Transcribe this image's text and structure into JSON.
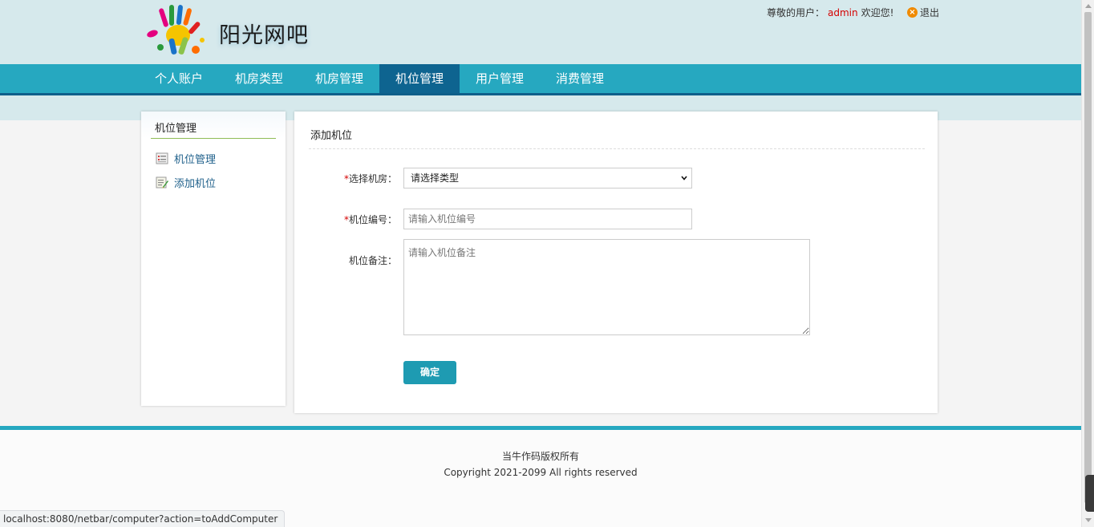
{
  "brand": {
    "site_name": "阳光网吧",
    "logo_icon": "colorful-hands-icon"
  },
  "userbar": {
    "greeting": "尊敬的用户：",
    "username": "admin",
    "welcome": "欢迎您!",
    "logout_label": "退出",
    "logout_icon": "logout-icon"
  },
  "nav": {
    "items": [
      {
        "label": "个人账户"
      },
      {
        "label": "机房类型"
      },
      {
        "label": "机房管理"
      },
      {
        "label": "机位管理"
      },
      {
        "label": "用户管理"
      },
      {
        "label": "消费管理"
      }
    ],
    "active_index": 3
  },
  "sidebar": {
    "title": "机位管理",
    "items": [
      {
        "label": "机位管理",
        "icon": "list-doc-icon"
      },
      {
        "label": "添加机位",
        "icon": "edit-doc-icon"
      }
    ]
  },
  "form": {
    "title": "添加机位",
    "required_mark": "*",
    "room_label": "选择机房：",
    "room_selected": "请选择类型",
    "number_label": "机位编号：",
    "number_placeholder": "请输入机位编号",
    "note_label": "机位备注：",
    "note_placeholder": "请输入机位备注",
    "submit_label": "确定"
  },
  "footer": {
    "line1": "当牛作码版权所有",
    "line2": "Copyright 2021-2099 All rights reserved"
  },
  "statusbar": {
    "url": "localhost:8080/netbar/computer?action=toAddComputer"
  },
  "colors": {
    "nav_bg": "#26a8c0",
    "nav_active": "#0e6490",
    "header_bg": "#d6e9ec",
    "accent_red": "#d40000",
    "button": "#1e9bb2"
  }
}
